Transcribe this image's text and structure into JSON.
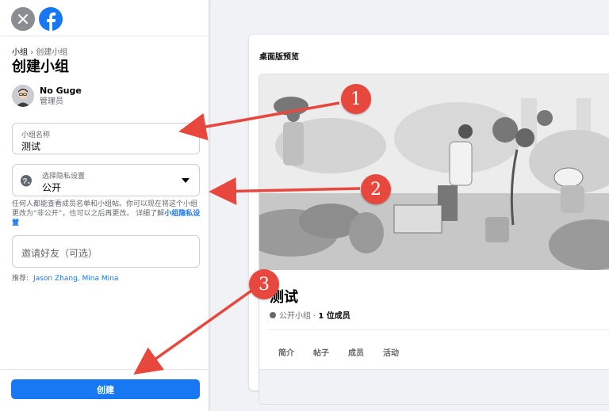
{
  "breadcrumb": {
    "root": "小组",
    "separator": "›",
    "current": "创建小组"
  },
  "page_title": "创建小组",
  "user": {
    "name": "No Guge",
    "role": "管理员"
  },
  "group_name_field": {
    "label": "小组名称",
    "value": "测试"
  },
  "privacy_field": {
    "label": "选择隐私设置",
    "value": "公开"
  },
  "privacy_help": {
    "text": "任何人都能查看成员名单和小组帖。你可以现在将这个小组更改为“非公开”，也可以之后再更改。 详细了解",
    "link": "小组隐私设置"
  },
  "invite_field": {
    "placeholder": "邀请好友（可选）"
  },
  "suggestions": {
    "label": "推荐:",
    "names": "Jason Zhang, Mina Mina"
  },
  "create_button": "创建",
  "preview": {
    "title": "桌面版预览",
    "group_name": "测试",
    "privacy": "公开小组 ·",
    "members": "1 位成员",
    "tabs": [
      "简介",
      "帖子",
      "成员",
      "活动"
    ]
  },
  "annotations": [
    "1",
    "2",
    "3"
  ],
  "colors": {
    "accent": "#1877f2",
    "marker": "#e8473d"
  }
}
